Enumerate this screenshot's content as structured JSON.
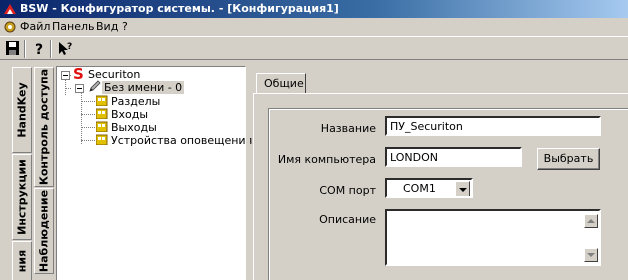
{
  "window": {
    "title": "BSW - Конфигуратор системы. - [Конфигурация1]"
  },
  "menu": {
    "items": [
      "Файл",
      "Панель",
      "Вид",
      "?"
    ]
  },
  "left_tabs": [
    "HandKey",
    "Контроль доступа",
    "Инструкции",
    "Наблюдение",
    "ния"
  ],
  "tree": {
    "root": "Securiton",
    "node": "Без имени - 0",
    "children": [
      "Разделы",
      "Входы",
      "Выходы",
      "Устройства оповещения"
    ]
  },
  "tabs": {
    "general": "Общие"
  },
  "form": {
    "name_label": "Название",
    "name_value": "ПУ_Securiton",
    "computer_label": "Имя компьютера",
    "computer_value": "LONDON",
    "choose_button": "Выбрать",
    "com_label": "COM порт",
    "com_value": "COM1",
    "desc_label": "Описание",
    "desc_value": ""
  },
  "colors": {
    "title_bar": "#0a246a",
    "logo_red": "#e01010",
    "face": "#d4d0c8"
  }
}
